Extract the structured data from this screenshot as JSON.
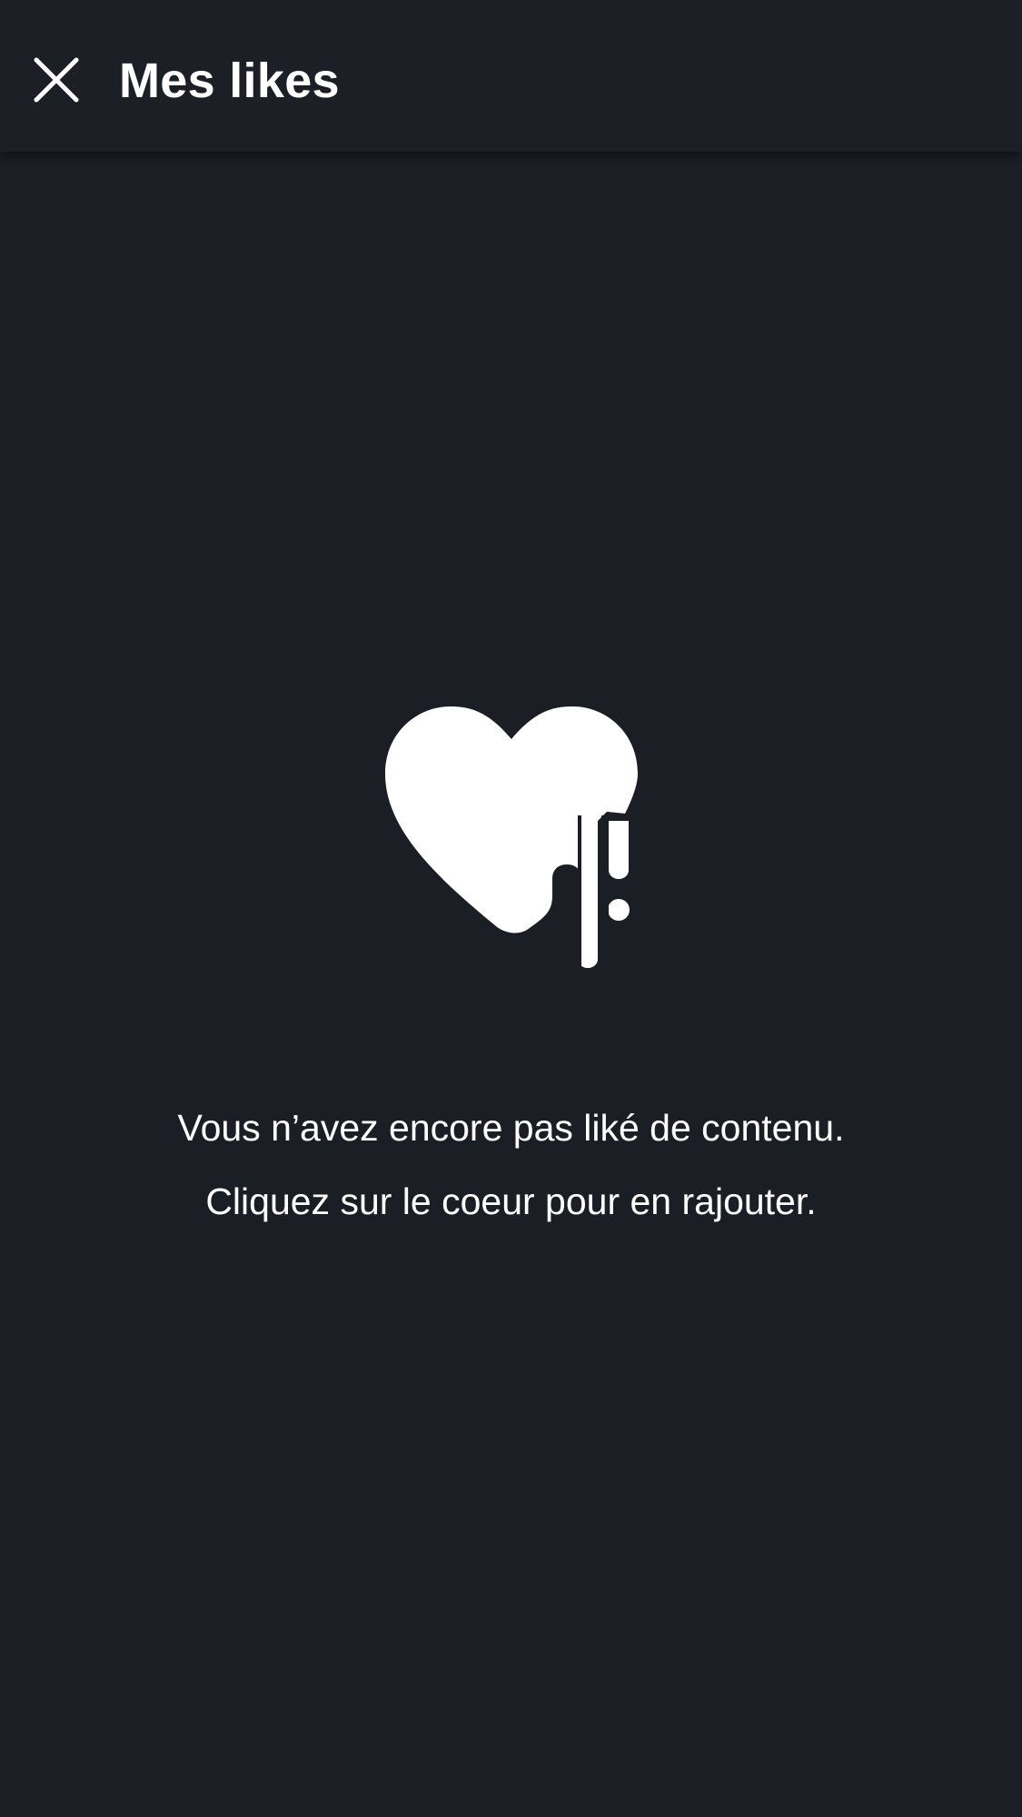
{
  "header": {
    "title": "Mes likes",
    "close_icon": "close-icon"
  },
  "empty_state": {
    "icon": "broken-heart-icon",
    "line1": "Vous n’avez encore pas liké de contenu.",
    "line2": "Cliquez sur le coeur pour en rajouter."
  },
  "colors": {
    "background": "#1b1e25",
    "header": "#1c1f26",
    "foreground": "#ffffff"
  }
}
